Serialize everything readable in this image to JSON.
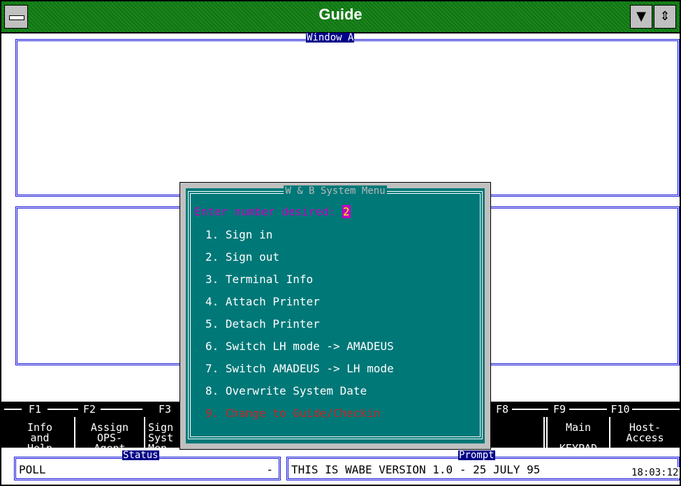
{
  "window": {
    "title": "Guide"
  },
  "title_buttons": {
    "down": "▼",
    "updown": "⇕"
  },
  "windowA": {
    "title": "Window A"
  },
  "fkeys": [
    {
      "key": "F1",
      "text": "Info\nand\nHelp"
    },
    {
      "key": "F2",
      "text": "Assign\nOPS-\nAgent"
    },
    {
      "key": "F3",
      "text": "Sign\nSyst\nMen"
    },
    {
      "key": "F8",
      "text": ""
    },
    {
      "key": "F9",
      "text": "Main\n\nKEYPAD"
    },
    {
      "key": "F10",
      "text": "Host-\nAccess"
    }
  ],
  "menu": {
    "title": "W & B System Menu",
    "prompt": "Enter number desired: ",
    "input": "2",
    "items": [
      "1. Sign in",
      "2. Sign out",
      "3. Terminal Info",
      "4. Attach Printer",
      "5. Detach Printer",
      "6. Switch LH mode -> AMADEUS",
      "7. Switch AMADEUS -> LH mode",
      "8. Overwrite System Date",
      "9. Change to Guide/Checkin"
    ]
  },
  "status": {
    "label": "Status",
    "value": "POLL",
    "dash": "-"
  },
  "prompt_box": {
    "label": "Prompt",
    "value": "THIS IS WABE VERSION 1.0 - 25 JULY 95"
  },
  "clock": "18:03:12",
  "colors": {
    "titlebar": "#0f7c12",
    "menu_bg": "#007878",
    "window_border": "#1010d8",
    "prompt": "#c000c0",
    "last_item": "#cc2222"
  }
}
